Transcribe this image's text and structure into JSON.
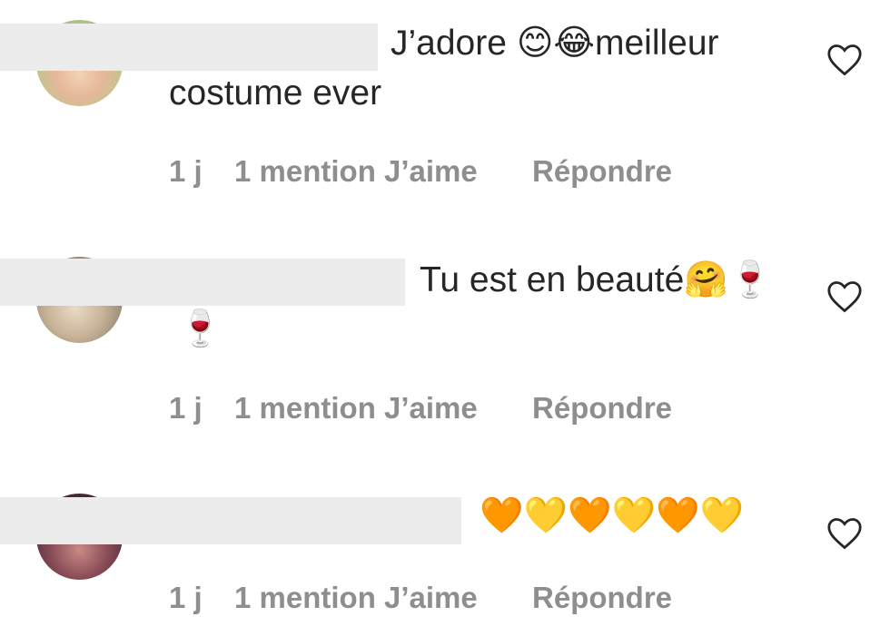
{
  "comments": [
    {
      "line1": "J’adore 😊😂meilleur",
      "line2": "costume ever",
      "time": "1 j",
      "likes": "1 mention J’aime",
      "reply": "Répondre"
    },
    {
      "line1": "Tu est en beauté🤗🍷",
      "line2": "🍷",
      "time": "1 j",
      "likes": "1 mention J’aime",
      "reply": "Répondre"
    },
    {
      "line1": "🧡💛🧡💛🧡💛",
      "line2": "",
      "time": "1 j",
      "likes": "1 mention J’aime",
      "reply": "Répondre"
    }
  ],
  "icons": {
    "like": "heart-outline-icon"
  },
  "colors": {
    "text": "#262626",
    "meta": "#8e8e8e",
    "redaction": "#ececec"
  }
}
